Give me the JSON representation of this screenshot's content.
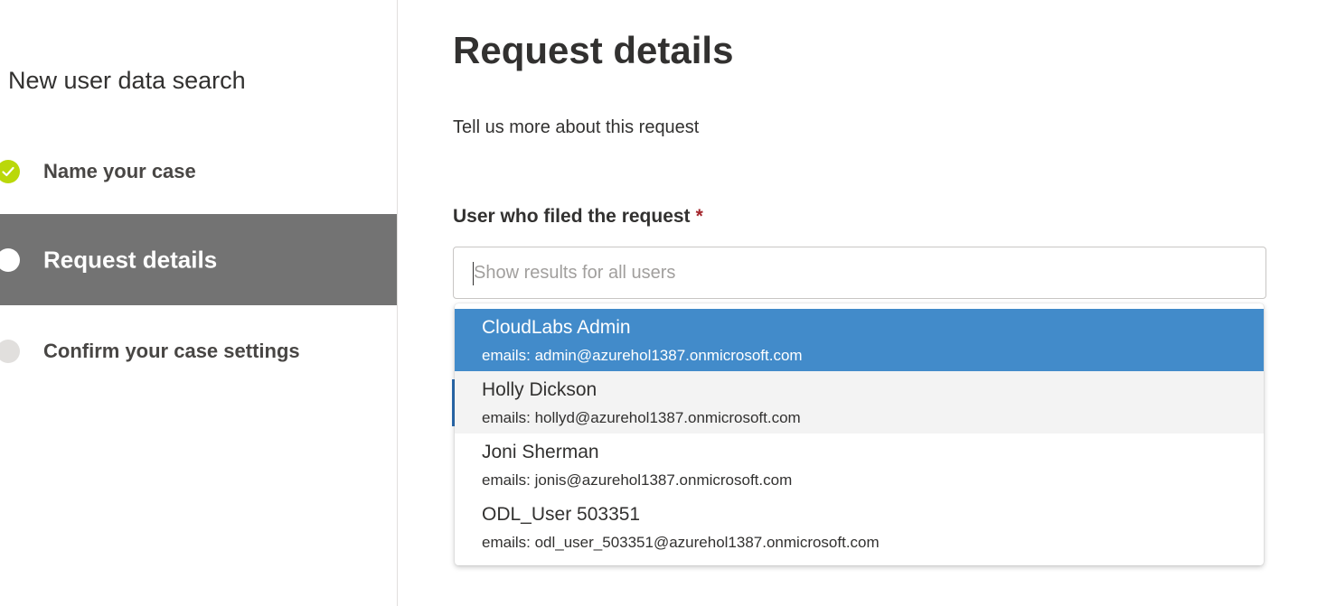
{
  "sidebar": {
    "title": "New user data search",
    "steps": [
      {
        "label": "Name your case",
        "state": "completed",
        "icon": "check-circle-icon"
      },
      {
        "label": "Request details",
        "state": "current",
        "icon": "circle-icon"
      },
      {
        "label": "Confirm your case settings",
        "state": "pending",
        "icon": "circle-icon"
      }
    ]
  },
  "main": {
    "title": "Request details",
    "description": "Tell us more about this request",
    "field": {
      "label": "User who filed the request",
      "required_marker": "*",
      "placeholder": "Show results for all users",
      "value": ""
    },
    "dropdown": {
      "options": [
        {
          "name": "CloudLabs Admin",
          "email": "emails: admin@azurehol1387.onmicrosoft.com",
          "state": "selected"
        },
        {
          "name": "Holly Dickson",
          "email": "emails: hollyd@azurehol1387.onmicrosoft.com",
          "state": "hovered"
        },
        {
          "name": "Joni Sherman",
          "email": "emails: jonis@azurehol1387.onmicrosoft.com",
          "state": "normal"
        },
        {
          "name": "ODL_User 503351",
          "email": "emails: odl_user_503351@azurehol1387.onmicrosoft.com",
          "state": "normal"
        }
      ]
    }
  },
  "colors": {
    "accent_selected": "#428bca",
    "step_done": "#bad80a",
    "step_current_bg": "#737373",
    "required": "#a4262c"
  }
}
